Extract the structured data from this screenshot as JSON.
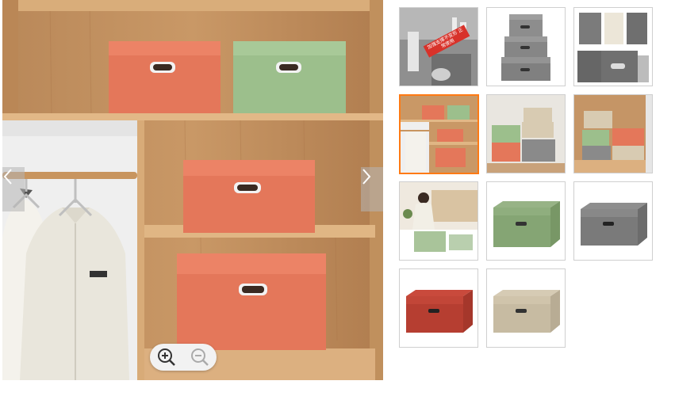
{
  "gallery": {
    "main_image": {
      "description_name": "orange-and-green-storage-boxes-on-wooden-shelf",
      "box_colors": {
        "orange": "#e4775a",
        "green": "#9cbf8c"
      }
    },
    "nav": {
      "prev_icon": "chevron-left-icon",
      "next_icon": "chevron-right-icon"
    },
    "zoom": {
      "zoom_in_icon": "zoom-in-icon",
      "zoom_out_icon": "zoom-out-icon"
    },
    "selected_index": 3,
    "thumbnails": [
      {
        "id": "bathroom-gray",
        "caption": "加强支撑不变形 正常使用"
      },
      {
        "id": "gray-stack",
        "caption": ""
      },
      {
        "id": "gray-detail",
        "caption": ""
      },
      {
        "id": "orange-shelf",
        "caption": ""
      },
      {
        "id": "mixed-stack",
        "caption": ""
      },
      {
        "id": "beige-shelf",
        "caption": ""
      },
      {
        "id": "woman-bed",
        "caption": ""
      },
      {
        "id": "green-box",
        "caption": ""
      },
      {
        "id": "gray-box",
        "caption": ""
      },
      {
        "id": "red-box",
        "caption": ""
      },
      {
        "id": "beige-box",
        "caption": ""
      }
    ],
    "accent_color": "#ff7a14"
  }
}
